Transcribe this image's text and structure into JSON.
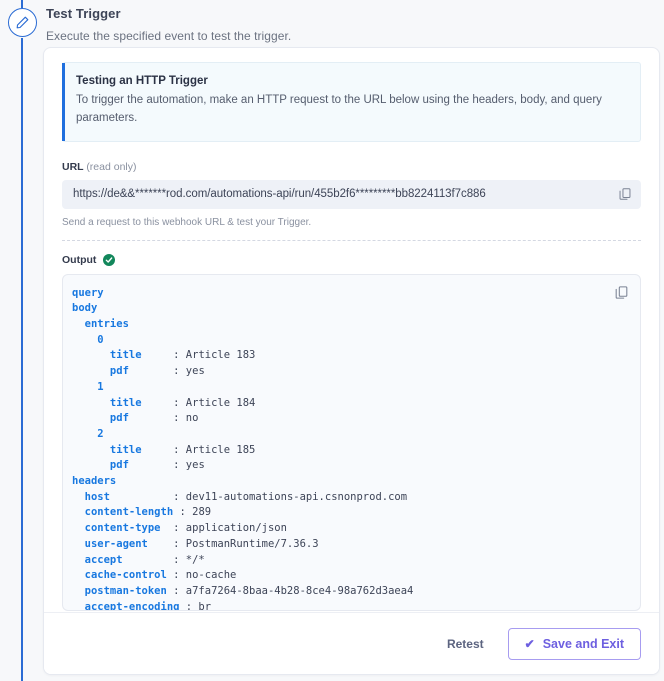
{
  "rail": {
    "icon": "pencil-edit-icon"
  },
  "header": {
    "title": "Test Trigger",
    "subtitle": "Execute the specified event to test the trigger."
  },
  "banner": {
    "title": "Testing an HTTP Trigger",
    "text": "To trigger the automation, make an HTTP request to the URL below using the headers, body, and query parameters.",
    "accent_color": "#1f6fde"
  },
  "url_field": {
    "label": "URL",
    "label_suffix": "(read only)",
    "value": "https://de&&*******rod.com/automations-api/run/455b2f6*********bb8224113f7c886",
    "copy_icon": "copy-icon",
    "hint": "Send a request to this webhook URL & test your Trigger."
  },
  "output": {
    "label": "Output",
    "status_icon": "check-circle-icon",
    "status_color": "#12875b",
    "copy_icon": "copy-icon",
    "rows": [
      {
        "indent": 0,
        "key": "query",
        "value": ""
      },
      {
        "indent": 0,
        "key": "body",
        "value": ""
      },
      {
        "indent": 1,
        "key": "entries",
        "value": ""
      },
      {
        "indent": 2,
        "key": "0",
        "value": ""
      },
      {
        "indent": 3,
        "key": "title",
        "value": "Article 183"
      },
      {
        "indent": 3,
        "key": "pdf",
        "value": "yes"
      },
      {
        "indent": 2,
        "key": "1",
        "value": ""
      },
      {
        "indent": 3,
        "key": "title",
        "value": "Article 184"
      },
      {
        "indent": 3,
        "key": "pdf",
        "value": "no"
      },
      {
        "indent": 2,
        "key": "2",
        "value": ""
      },
      {
        "indent": 3,
        "key": "title",
        "value": "Article 185"
      },
      {
        "indent": 3,
        "key": "pdf",
        "value": "yes"
      },
      {
        "indent": 0,
        "key": "headers",
        "value": ""
      },
      {
        "indent": 1,
        "key": "host",
        "value": "dev11-automations-api.csnonprod.com"
      },
      {
        "indent": 1,
        "key": "content-length",
        "value": "289"
      },
      {
        "indent": 1,
        "key": "content-type",
        "value": "application/json"
      },
      {
        "indent": 1,
        "key": "user-agent",
        "value": "PostmanRuntime/7.36.3"
      },
      {
        "indent": 1,
        "key": "accept",
        "value": "*/*"
      },
      {
        "indent": 1,
        "key": "cache-control",
        "value": "no-cache"
      },
      {
        "indent": 1,
        "key": "postman-token",
        "value": "a7fa7264-8baa-4b28-8ce4-98a762d3aea4"
      },
      {
        "indent": 1,
        "key": "accept-encoding",
        "value": "br"
      }
    ]
  },
  "footer": {
    "retest_label": "Retest",
    "save_label": "Save and Exit",
    "save_check_glyph": "✔",
    "save_color": "#6d5fe0"
  }
}
